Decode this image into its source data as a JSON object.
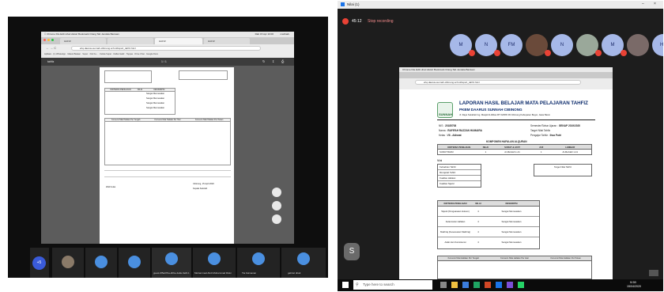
{
  "left": {
    "mac_menu": [
      "Chrome",
      "File",
      "Edit",
      "Lihat",
      "Histori",
      "Bookmark",
      "Orang",
      "Tab",
      "Jendela",
      "Bantuan"
    ],
    "mac_status": "Rab 15 Apr 10:00",
    "mac_user": "mazbark",
    "tabs": [
      "HAFIZ",
      "",
      "HAFIZ",
      "HAFIZ"
    ],
    "url": "ehq.daarus-sunnah-cibinong.sch.id/raport_tahfiz.html",
    "bookmarks": [
      "Aplikasi",
      "(1) WhatsApp",
      "Masuk Bataan",
      "Super",
      "Kilo Ke...",
      "Kelola Super",
      "Daftar Hadir",
      "Toppas",
      "Drive Chat",
      "Google Docs"
    ],
    "pdf_title": "tahfiz",
    "page_indicator": "1 / 1",
    "doc_headers": [
      "KRITERIA PENILAIAN",
      "NILAI",
      "DESKRIPSI"
    ],
    "doc_descriptions": [
      "Sangat Memuaskan",
      "Sangat Memuaskan",
      "Sangat Memuaskan",
      "Sangat Memuaskan"
    ],
    "doc_table2_headers": [
      "Konversi Nilai Hafalan Per Tengah",
      "Konversi Nilai Hafalan Per Hari",
      "Konversi Nilai Hafalan Per Pekan"
    ],
    "doc_footer_left": "Wali Kelas",
    "doc_footer_right": "Cibinong, 15 April 2020",
    "doc_footer_sign": "Kepala Sekolah",
    "tile_count": "+5",
    "participants": [
      "guest-6f5a37ba-2b6e-4a0e-9e0f-1...",
      "Muhammad Abdi Muhammad Riski",
      "Tia Faimanan",
      "gabriel dirait"
    ]
  },
  "right": {
    "window_title": "Nilai (1)",
    "meeting_time": "45:12",
    "meeting_status": "Stop recording",
    "avatars": [
      "M",
      "N",
      "FM",
      "",
      "N",
      "H",
      "M",
      "AM",
      "HF",
      "R",
      "HH"
    ],
    "mac_menu": [
      "Chrome",
      "File",
      "Edit",
      "Lihat",
      "Histori",
      "Bookmark",
      "Orang",
      "Tab",
      "Jendela",
      "Bantuan"
    ],
    "url": "ehq.daarus-sunnah-cibinong.sch.id/raport_tahfiz.html",
    "doc_title": "LAPORAN HASIL BELAJAR MATA PELAJARAN TAHFIZ",
    "doc_subtitle": "PKBM DAARUS SUNNAH CIBINONG",
    "doc_address": "Jl. Raya Sukahati Gg. Masjid Al-Ikhlas RT 02/RW 09 Cibinong Kabupaten Bogor, Jawa Barat",
    "logo_text": "SUNNAH",
    "info_left": [
      [
        "NIS",
        "20185708"
      ],
      [
        "Nama",
        "RAFIFAH RAZZAN HUMAIRA"
      ],
      [
        "Kelas",
        "VII - Akhwat"
      ]
    ],
    "info_right": [
      [
        "Semester/Tahun Ajaran",
        "GENAP 2019/2020"
      ],
      [
        "Target Nilai Tahfiz",
        ""
      ],
      [
        "Pengajar Tahfiz",
        "Ihsa Putri"
      ]
    ],
    "section_title": "KOMPONEN HAFALAN ALQURAN",
    "table1_headers": [
      "KRITERIA PENILAIAN",
      "NILAI",
      "SURAT & AYAT",
      "JUZ",
      "LEMBAR"
    ],
    "table1_row": [
      "SURAT BARU",
      "1",
      "Al-Ma'idah 1-41",
      "1",
      "Al-Ma'idah 1-41"
    ],
    "notes_label": "Nilai",
    "notes_fields": [
      "Kehadiran Tahfiz",
      "Muroja'ah Tahfiz",
      "Kualitas Hafalan",
      "Kualitas Tajwid"
    ],
    "target_label": "Target Nilai Tahfiz",
    "table2_headers": [
      "KRITERIA PENILAIAN",
      "NILAI",
      "DESKRIPSI"
    ],
    "table2_rows": [
      [
        "Tajwid (Penguasaan Hukum)",
        "4",
        "Sangat Memuaskan"
      ],
      [
        "Kelancaran Hafalan",
        "4",
        "Sangat Memuaskan"
      ],
      [
        "Makhraj (Kesesuaian Makhraj)",
        "4",
        "Sangat Memuaskan"
      ],
      [
        "Adab dan Konsistensi",
        "4",
        "Sangat Memuaskan"
      ]
    ],
    "table3_headers": [
      "Konversi Nilai Hafalan Per Tengah",
      "Konversi Nilai Hafalan Per Hari",
      "Konversi Nilai Hafalan Per Pekan"
    ],
    "taskbar_search": "Type here to search",
    "taskbar_time": "9:59",
    "taskbar_date": "15/04/2020"
  },
  "colors": {
    "meeting_bg": "#1d1d1d",
    "avatar_blue": "#a6b8e8",
    "record_red": "#e94235",
    "doc_title_blue": "#0b2a6b"
  }
}
